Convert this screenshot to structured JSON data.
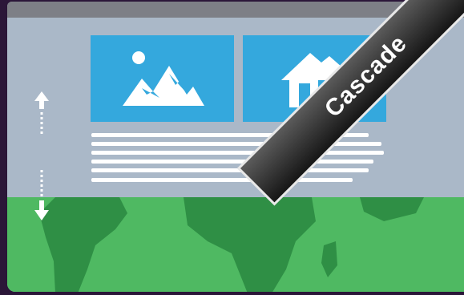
{
  "ribbon": {
    "label": "Cascade"
  },
  "images": {
    "landscape": "mountain-landscape-icon",
    "home": "house-icon"
  },
  "colors": {
    "background": "#2b1638",
    "window": "#aab8c8",
    "titlebar": "#7d7f86",
    "tile": "#34a8dd",
    "map": "#4fb962",
    "continents": "#2f8f45"
  }
}
